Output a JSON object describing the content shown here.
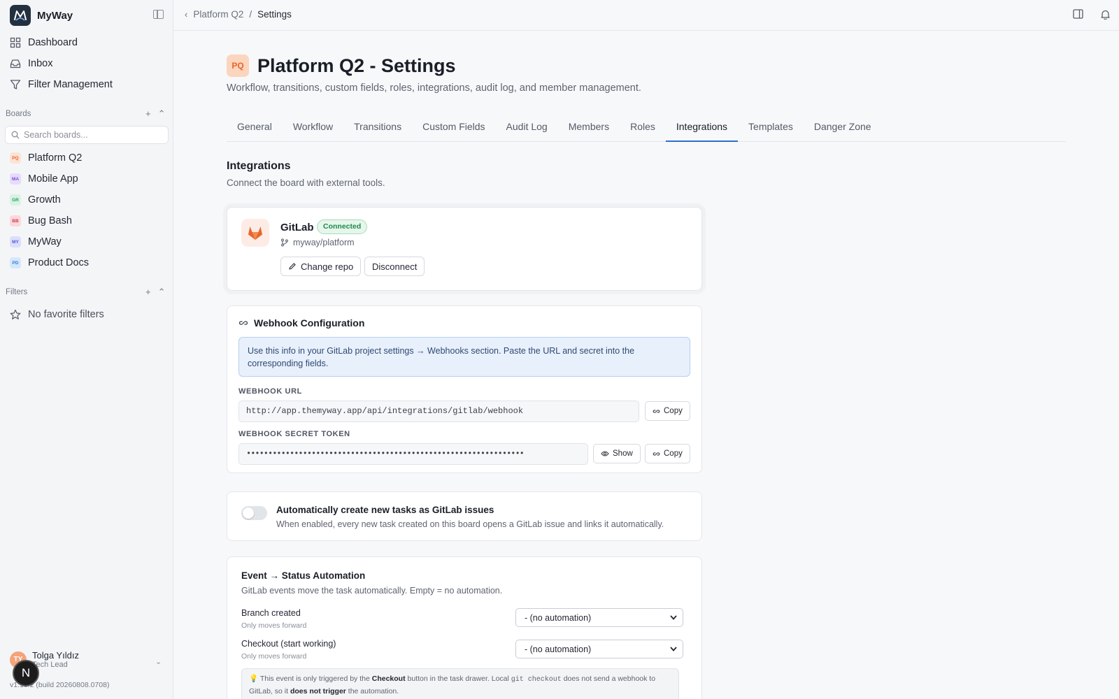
{
  "brand": {
    "name": "MyWay"
  },
  "nav": [
    {
      "label": "Dashboard",
      "icon": "dashboard-icon"
    },
    {
      "label": "Inbox",
      "icon": "inbox-icon"
    },
    {
      "label": "Filter Management",
      "icon": "filter-icon"
    }
  ],
  "boards": {
    "label": "Boards",
    "search_placeholder": "Search boards...",
    "items": [
      {
        "badge": "PQ",
        "label": "Platform Q2",
        "bg": "#fde3d4",
        "fg": "#e9652a"
      },
      {
        "badge": "MA",
        "label": "Mobile App",
        "bg": "#e6dcfb",
        "fg": "#7b4fd6"
      },
      {
        "badge": "GR",
        "label": "Growth",
        "bg": "#d7f3e3",
        "fg": "#2e9a5f"
      },
      {
        "badge": "BB",
        "label": "Bug Bash",
        "bg": "#fbd8dc",
        "fg": "#d73a4f"
      },
      {
        "badge": "MY",
        "label": "MyWay",
        "bg": "#dcdffb",
        "fg": "#5158d2"
      },
      {
        "badge": "PD",
        "label": "Product Docs",
        "bg": "#d6e7fb",
        "fg": "#3a7bd5"
      }
    ]
  },
  "filters": {
    "label": "Filters",
    "empty": "No favorite filters"
  },
  "user": {
    "initials": "TY",
    "name": "Tolga Yıldız",
    "role": "Tech Lead",
    "version": "v1.18.2 (build 20260808.0708)"
  },
  "fab": {
    "letter": "N"
  },
  "breadcrumb": {
    "parent": "Platform Q2",
    "separator": "/",
    "current": "Settings"
  },
  "page": {
    "badge": "PQ",
    "title": "Platform Q2 - Settings",
    "subtitle": "Workflow, transitions, custom fields, roles, integrations, audit log, and member management."
  },
  "tabs": [
    "General",
    "Workflow",
    "Transitions",
    "Custom Fields",
    "Audit Log",
    "Members",
    "Roles",
    "Integrations",
    "Templates",
    "Danger Zone"
  ],
  "active_tab": "Integrations",
  "integrations": {
    "title": "Integrations",
    "subtitle": "Connect the board with external tools.",
    "gitlab": {
      "name": "GitLab",
      "status": "Connected",
      "repo": "myway/platform",
      "change_label": "Change repo",
      "disconnect_label": "Disconnect"
    },
    "webhook": {
      "title": "Webhook Configuration",
      "info": "Use this info in your GitLab project settings → Webhooks section. Paste the URL and secret into the corresponding fields.",
      "url_label": "WEBHOOK URL",
      "url": "http://app.themyway.app/api/integrations/gitlab/webhook",
      "copy_label": "Copy",
      "secret_label": "WEBHOOK SECRET TOKEN",
      "secret_masked": "••••••••••••••••••••••••••••••••••••••••••••••••••••••••••••••••",
      "show_label": "Show"
    },
    "auto_create": {
      "title": "Automatically create new tasks as GitLab issues",
      "description": "When enabled, every new task created on this board opens a GitLab issue and links it automatically.",
      "enabled": false
    },
    "automation": {
      "title": "Event → Status Automation",
      "subtitle": "GitLab events move the task automatically. Empty = no automation.",
      "rules": [
        {
          "label": "Branch created",
          "help": "Only moves forward",
          "value": "- (no automation)"
        },
        {
          "label": "Checkout (start working)",
          "help": "Only moves forward",
          "value": "- (no automation)"
        }
      ],
      "note": {
        "icon": "💡",
        "t1": "This event is only triggered by the",
        "b1": "Checkout",
        "t2": "button in the task drawer. Local",
        "code": "git checkout",
        "t3": "does not send a webhook to GitLab, so it",
        "b2": "does not trigger",
        "t4": "the automation."
      }
    }
  },
  "colors": {
    "accent": "#2e6fd0",
    "success": "#1f8a4c",
    "gitlab": "#e9652a"
  }
}
